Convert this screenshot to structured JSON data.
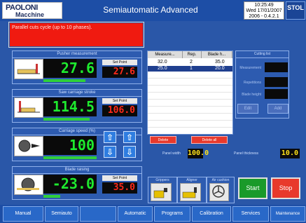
{
  "header": {
    "logo_line1": "PAOLONI",
    "logo_line2": "Macchine",
    "title": "Semiautomatic Advanced",
    "time": "10:25:49",
    "date": "Wed 17/01/2007",
    "version": "2006 - 0.4.2.1",
    "brand_logo": "STOL"
  },
  "message": "Parallel cuts cycle (up to 10 phases).",
  "pusher": {
    "title": "Pusher measurement",
    "value": "27.6",
    "setpoint_label": "Set Point",
    "setpoint": "27.6"
  },
  "saw": {
    "title": "Saw carriage stroke",
    "value": "114.5",
    "setpoint_label": "Set Point",
    "setpoint": "106.0"
  },
  "speed": {
    "title": "Carriage speed (%)",
    "value": "100"
  },
  "blade": {
    "title": "Blade raising",
    "value": "-23.0",
    "setpoint_label": "Set Point",
    "setpoint": "35.0"
  },
  "table": {
    "columns": [
      "Measure...",
      "Rep.",
      "Blade h..."
    ],
    "rows": [
      {
        "measure": "32.0",
        "rep": "2",
        "blade": "35.0"
      },
      {
        "measure": "25.0",
        "rep": "1",
        "blade": "20.0"
      }
    ],
    "delete_label": "Delete",
    "delete_all_label": "Delete all"
  },
  "cutting_list": {
    "title": "Cutting list",
    "measurement_label": "Measurement",
    "repetitions_label": "Repetitions",
    "blade_height_label": "Blade height",
    "edit_label": "Edit",
    "add_label": "Add"
  },
  "panel_width": {
    "label": "Panel width",
    "value": "100.0"
  },
  "panel_thickness": {
    "label": "Panel thickness",
    "value": "10.0"
  },
  "devices": {
    "grippers": "Grippers",
    "aligner": "Aligner",
    "air_cushion": "Air cushion"
  },
  "start_label": "Start",
  "stop_label": "Stop",
  "nav": [
    "Manual",
    "Semiauto",
    "Automatic",
    "Programs",
    "Calibration",
    "Services",
    "Maintenance"
  ],
  "colors": {
    "lcd_green": "#1eea2e",
    "lcd_red": "#ff2a1a",
    "start": "#1a9a2a",
    "stop": "#e8392c"
  }
}
